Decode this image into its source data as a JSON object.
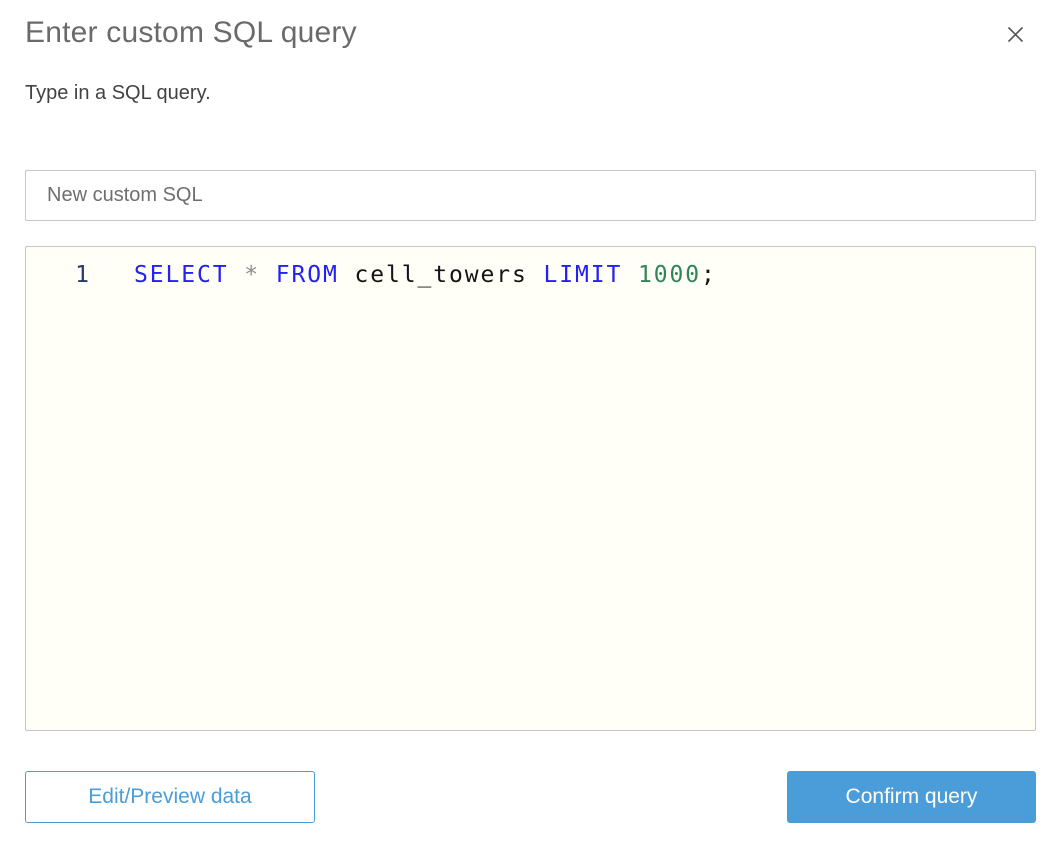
{
  "colors": {
    "accent-blue": "#4a9dd9",
    "title-gray": "#6a6a6a",
    "subtitle-gray": "#424242",
    "border-gray": "#c6c6c6",
    "editor-bg": "#fffef7",
    "line-number-navy": "#223a70",
    "keyword-blue": "#2321f5",
    "operator-gray": "#8d8d8d",
    "identifier-black": "#141414",
    "number-green": "#2f8656",
    "input-text-gray": "#6e6e6e",
    "close-gray": "#565656"
  },
  "dialog": {
    "title": "Enter custom SQL query",
    "subtitle": "Type in a SQL query.",
    "close_icon": "close-x"
  },
  "name_input": {
    "value": "New custom SQL"
  },
  "editor": {
    "lines": [
      {
        "number": "1",
        "tokens": [
          {
            "type": "keyword",
            "text": "SELECT"
          },
          {
            "type": "plain",
            "text": " "
          },
          {
            "type": "operator",
            "text": "*"
          },
          {
            "type": "plain",
            "text": " "
          },
          {
            "type": "keyword",
            "text": "FROM"
          },
          {
            "type": "identifier",
            "text": " cell_towers "
          },
          {
            "type": "keyword",
            "text": "LIMIT"
          },
          {
            "type": "plain",
            "text": " "
          },
          {
            "type": "number",
            "text": "1000"
          },
          {
            "type": "identifier",
            "text": ";"
          }
        ]
      }
    ]
  },
  "footer": {
    "edit_preview_label": "Edit/Preview data",
    "confirm_label": "Confirm query"
  }
}
